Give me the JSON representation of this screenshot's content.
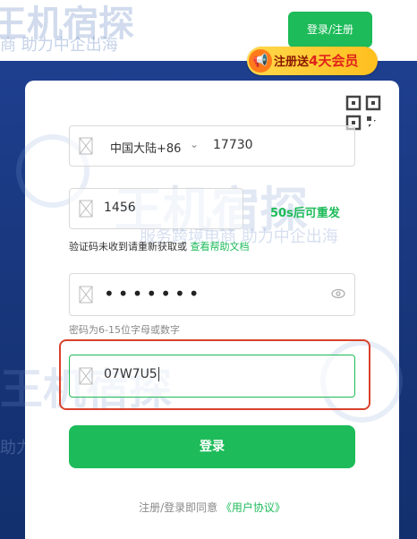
{
  "header": {
    "login_register_label": "登录/注册",
    "promo": {
      "prefix": "注册送",
      "highlight": "4天会员"
    }
  },
  "watermark": {
    "logo_text": "王机宿探",
    "slogan": "服务跨境电商  助力中企出海",
    "slogan_top_fragment": "商  助力中企出海",
    "slogan_bottom_fragment": "助力中企出海"
  },
  "form": {
    "phone": {
      "country": "中国大陆+86",
      "value": "17730"
    },
    "code": {
      "value": "1456",
      "resend": "50s后可重发"
    },
    "code_hint": {
      "text": "验证码未收到请重新获取或 ",
      "link": "查看帮助文档"
    },
    "password": {
      "masked": "•••••••",
      "hint": "密码为6-15位字母或数字"
    },
    "captcha": {
      "value": "07W7U5"
    },
    "submit_label": "登录",
    "agreement": {
      "text": "注册/登录即同意 ",
      "link": "《用户协议》"
    }
  },
  "colors": {
    "accent": "#1dbb59",
    "highlight_border": "#d9412b",
    "backdrop": "#1e3f8f"
  },
  "icons": [
    "qr-code-icon",
    "placeholder-icon",
    "chevron-down-icon",
    "eye-icon",
    "megaphone-icon"
  ]
}
